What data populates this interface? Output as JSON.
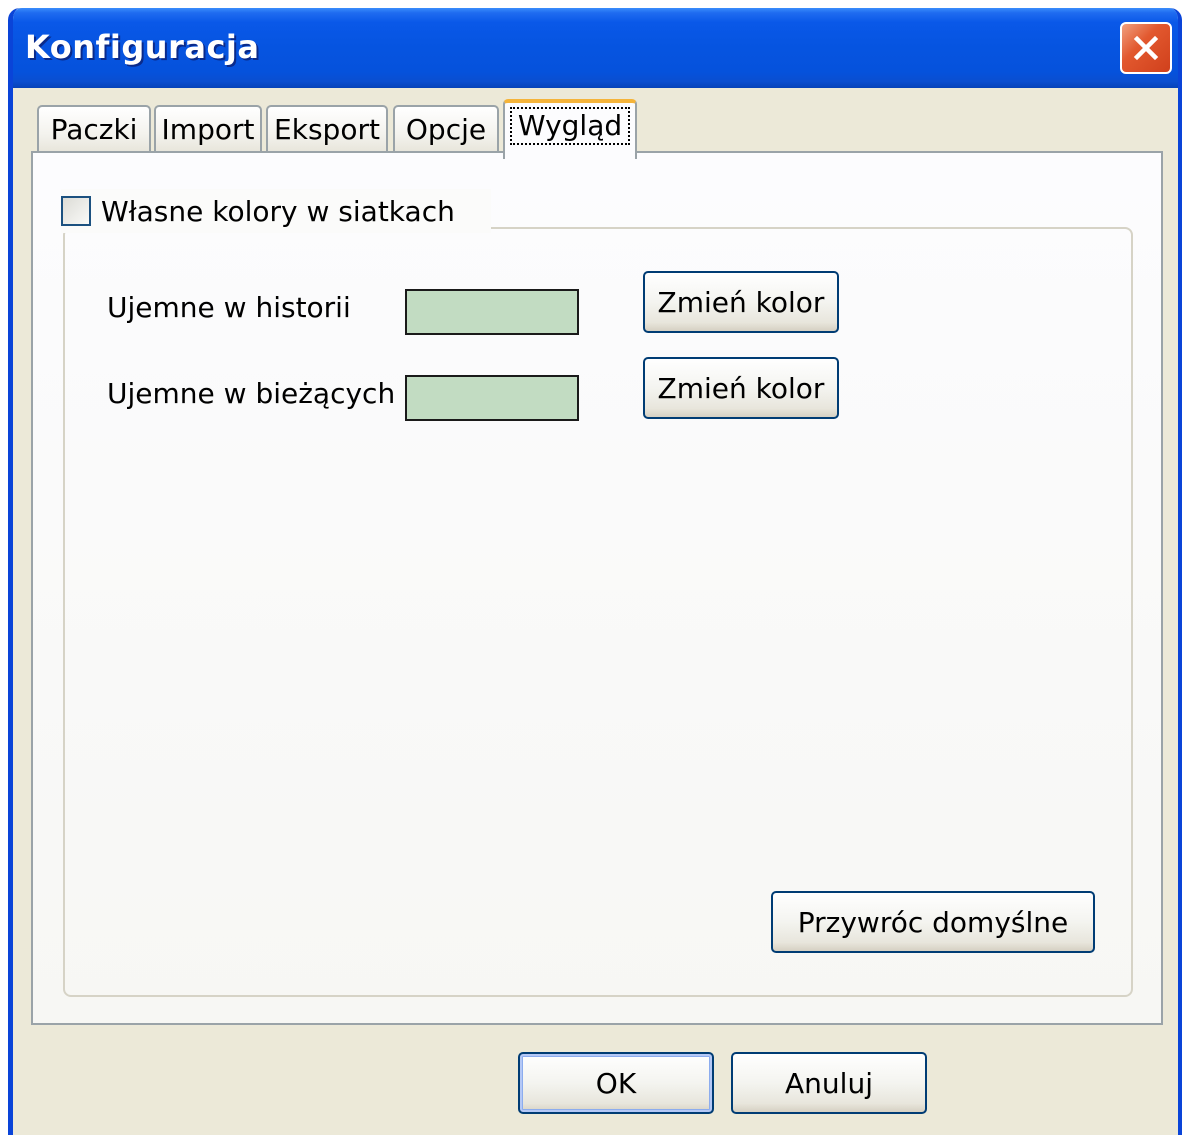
{
  "window": {
    "title": "Konfiguracja"
  },
  "tabs": [
    {
      "label": "Paczki",
      "active": false
    },
    {
      "label": "Import",
      "active": false
    },
    {
      "label": "Eksport",
      "active": false
    },
    {
      "label": "Opcje",
      "active": false
    },
    {
      "label": "Wygląd",
      "active": true
    }
  ],
  "appearance": {
    "custom_colors_checkbox": {
      "label": "Własne kolory w siatkach",
      "checked": false
    },
    "rows": [
      {
        "label": "Ujemne w historii",
        "swatch_color": "#c2dcc2",
        "button_label": "Zmień kolor"
      },
      {
        "label": "Ujemne w bieżących",
        "swatch_color": "#c2dcc2",
        "button_label": "Zmień kolor"
      }
    ],
    "restore_defaults_label": "Przywróc domyślne"
  },
  "footer": {
    "ok_label": "OK",
    "cancel_label": "Anuluj"
  },
  "colors": {
    "titlebar": "#0654e0",
    "window_bg": "#ece9d8",
    "active_tab_highlight": "#f5b43a",
    "button_border": "#003c74",
    "close_button": "#e2582e"
  }
}
